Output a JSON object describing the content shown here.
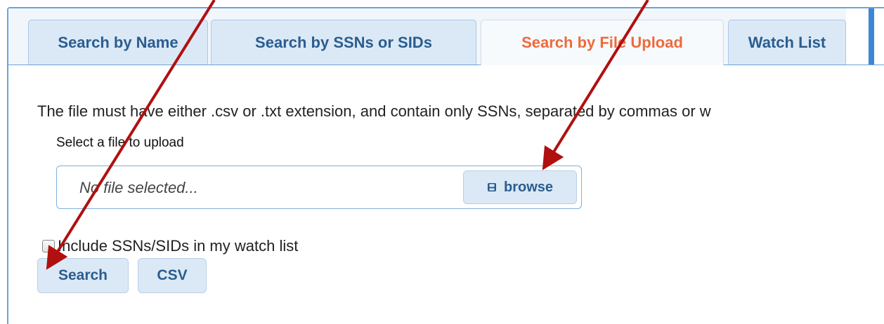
{
  "tabs": [
    {
      "label": "Search by Name"
    },
    {
      "label": "Search by SSNs or SIDs"
    },
    {
      "label": "Search by File Upload",
      "active": true
    },
    {
      "label": "Watch List"
    }
  ],
  "upload": {
    "instructions": "The file must have either .csv or .txt extension, and contain only SSNs, separated by commas or w",
    "field_label": "Select a file to upload",
    "placeholder": "No file selected...",
    "browse_label": "browse",
    "browse_icon": "save-icon"
  },
  "options": {
    "watchlist_checkbox_label": "Include SSNs/SIDs in my watch list",
    "checked": false
  },
  "actions": {
    "search_label": "Search",
    "csv_label": "CSV"
  },
  "colors": {
    "tab_text": "#2b5d8f",
    "active_tab_text": "#ee6a3c",
    "border": "#6aa3dc",
    "button_bg": "#dbe9f6",
    "annotation_arrow": "#b01010"
  }
}
